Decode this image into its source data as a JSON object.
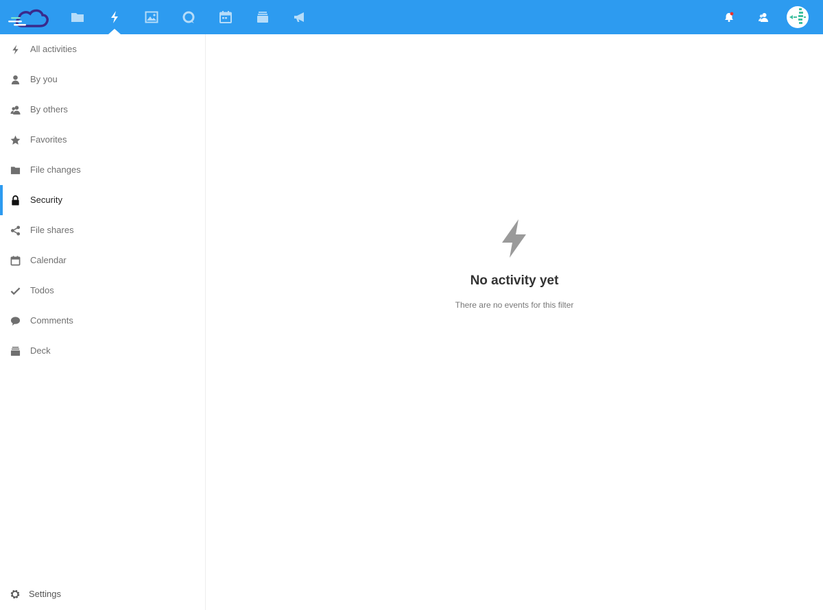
{
  "colors": {
    "header_bg": "#2d9bf0",
    "accent": "#2d9bf0",
    "icon_gray": "#6f6f6f",
    "notification_dot": "#e9322d"
  },
  "header": {
    "apps": [
      {
        "name": "Files",
        "icon": "folder-icon"
      },
      {
        "name": "Activity",
        "icon": "lightning-icon",
        "active": true
      },
      {
        "name": "Photos",
        "icon": "image-icon"
      },
      {
        "name": "Talk",
        "icon": "chat-bubble-icon"
      },
      {
        "name": "Calendar",
        "icon": "calendar-icon"
      },
      {
        "name": "Deck",
        "icon": "deck-icon"
      },
      {
        "name": "Announcements",
        "icon": "megaphone-icon"
      }
    ],
    "right": [
      {
        "name": "Notifications",
        "icon": "bell-icon"
      },
      {
        "name": "Contacts",
        "icon": "contacts-icon"
      },
      {
        "name": "User menu",
        "icon": "avatar"
      }
    ]
  },
  "sidebar": {
    "items": [
      {
        "label": "All activities",
        "icon": "lightning-icon"
      },
      {
        "label": "By you",
        "icon": "user-icon"
      },
      {
        "label": "By others",
        "icon": "users-icon"
      },
      {
        "label": "Favorites",
        "icon": "star-icon"
      },
      {
        "label": "File changes",
        "icon": "folder-icon"
      },
      {
        "label": "Security",
        "icon": "lock-icon",
        "active": true
      },
      {
        "label": "File shares",
        "icon": "share-icon"
      },
      {
        "label": "Calendar",
        "icon": "calendar-icon"
      },
      {
        "label": "Todos",
        "icon": "checkmark-icon"
      },
      {
        "label": "Comments",
        "icon": "comment-icon"
      },
      {
        "label": "Deck",
        "icon": "deck-icon"
      }
    ],
    "settings_label": "Settings"
  },
  "empty_state": {
    "icon": "lightning-icon",
    "title": "No activity yet",
    "subtitle": "There are no events for this filter"
  }
}
